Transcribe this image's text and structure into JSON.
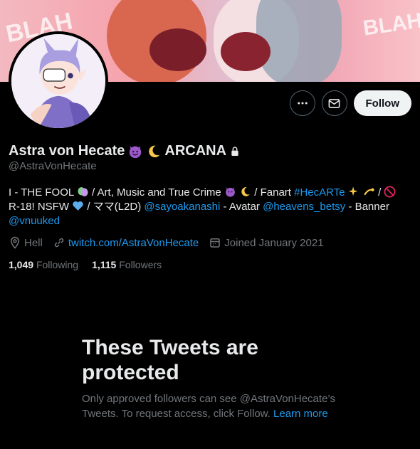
{
  "banner": {
    "text_left": "BLAH",
    "text_right": "BLAH"
  },
  "actions": {
    "more_label": "•••",
    "follow_label": "Follow"
  },
  "profile": {
    "name": "Astra von Hecate",
    "name_suffix": "ARCANA",
    "handle": "@AstraVonHecate"
  },
  "bio": {
    "p1": "I - THE FOOL",
    "p2": " / Art, Music and True Crime ",
    "p3": " / Fanart ",
    "p4": "#HecARTe",
    "p5": " / ",
    "p6": "R-18! NSFW ",
    "p7": " / ママ(L2D) ",
    "p8": "@sayoakanashi",
    "p9": " - Avatar ",
    "p10": "@heavens_betsy",
    "p11": " - Banner",
    "p12": "@vnuuked"
  },
  "meta": {
    "location": "Hell",
    "website": "twitch.com/AstraVonHecate",
    "joined": "Joined January 2021"
  },
  "counts": {
    "following_count": "1,049",
    "following_label": "Following",
    "followers_count": "1,115",
    "followers_label": "Followers"
  },
  "protected": {
    "heading": "These Tweets are protected",
    "text": "Only approved followers can see @AstraVonHecate’s Tweets. To request access, click Follow.",
    "link": "Learn more"
  },
  "colors": {
    "accent": "#1d9bf0",
    "muted": "#71767b",
    "text": "#e7e9ea",
    "background": "#000000"
  },
  "icons": [
    "more-icon",
    "message-icon",
    "lock-icon",
    "location-icon",
    "link-icon",
    "calendar-icon"
  ]
}
